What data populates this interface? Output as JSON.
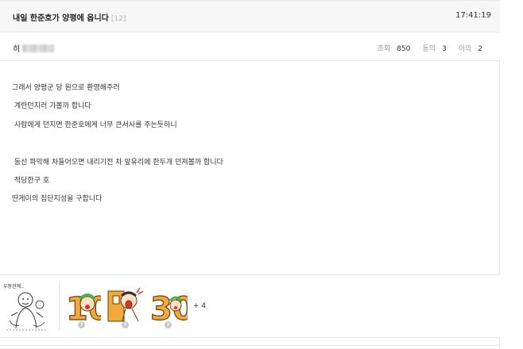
{
  "post": {
    "title": "내일 한준호가 양평에 옵니다",
    "comment_count": "[12]",
    "time": "17:41:19",
    "author": "히"
  },
  "stats": {
    "views_label": "조회",
    "views_value": "850",
    "agree_label": "동의",
    "agree_value": "3",
    "disagree_label": "이의",
    "disagree_value": "2"
  },
  "body_lines": [
    "그래서 양평군 당 원으로 환영해주러",
    " 계란던지러 가볼까 합니다",
    " 사람에게 던지면 한준호에게 너무 큰서사를 주는듯하니",
    " 동선 파악해 차들어오면 내리기전 차 앞유리에 한두개 던져볼까 합니다",
    " 적당한구 호",
    "딴게이의 집단지성을 구합니다"
  ],
  "stickers": {
    "first_caption": "우동관계..",
    "sticker2_text": "10",
    "sticker4_text": "30",
    "more": "+ 4",
    "help_glyph": "?"
  },
  "colors": {
    "accent_orange": "#f2a93b",
    "accent_green": "#4caf50",
    "accent_red": "#d9342b"
  }
}
